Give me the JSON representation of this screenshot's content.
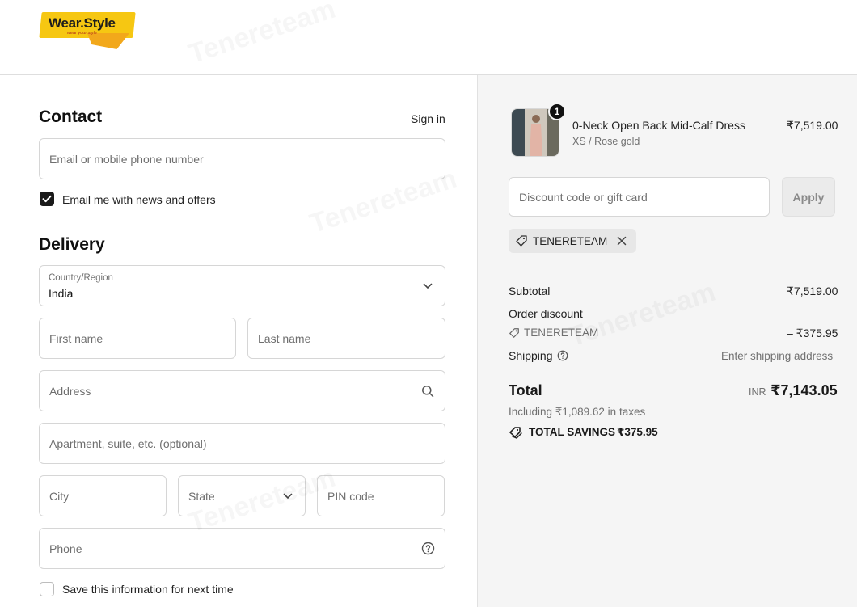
{
  "brand": {
    "name": "Wear.Style",
    "tagline": "wear your style",
    "colors": {
      "primary": "#f6c712",
      "secondary": "#f2a81b"
    }
  },
  "contact": {
    "heading": "Contact",
    "sign_in_label": "Sign in",
    "email_placeholder": "Email or mobile phone number",
    "newsletter_label": "Email me with news and offers",
    "newsletter_checked": true
  },
  "delivery": {
    "heading": "Delivery",
    "country_label": "Country/Region",
    "country_value": "India",
    "first_name_placeholder": "First name",
    "last_name_placeholder": "Last name",
    "address_placeholder": "Address",
    "apartment_placeholder": "Apartment, suite, etc. (optional)",
    "city_placeholder": "City",
    "state_placeholder": "State",
    "pin_placeholder": "PIN code",
    "phone_placeholder": "Phone",
    "save_info_label": "Save this information for next time",
    "save_info_checked": false
  },
  "summary": {
    "item": {
      "quantity": "1",
      "name": "0-Neck Open Back Mid-Calf Dress",
      "variant": "XS / Rose gold",
      "price": "₹7,519.00"
    },
    "discount_placeholder": "Discount code or gift card",
    "apply_label": "Apply",
    "applied_code": "TENERETEAM",
    "subtotal_label": "Subtotal",
    "subtotal_value": "₹7,519.00",
    "order_discount_label": "Order discount",
    "order_discount_code": "TENERETEAM",
    "order_discount_value": "– ₹375.95",
    "shipping_label": "Shipping",
    "shipping_value": "Enter shipping address",
    "total_label": "Total",
    "currency": "INR",
    "total_value": "₹7,143.05",
    "taxes_note": "Including ₹1,089.62 in taxes",
    "savings_label": "TOTAL SAVINGS",
    "savings_value": "₹375.95"
  },
  "watermark": "Tenereteam"
}
